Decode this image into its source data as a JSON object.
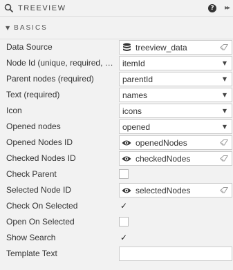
{
  "header": {
    "title": "TREEVIEW",
    "help_glyph": "?",
    "expand_glyph": "▸▸"
  },
  "section": {
    "caret": "▼",
    "title": "BASICS"
  },
  "rows": [
    {
      "label": "Data Source",
      "type": "binding",
      "icon": "database-icon",
      "value": "treeview_data"
    },
    {
      "label": "Node Id (unique, required, …",
      "type": "select",
      "value": "itemId"
    },
    {
      "label": "Parent nodes (required)",
      "type": "select",
      "value": "parentId"
    },
    {
      "label": "Text (required)",
      "type": "select",
      "value": "names"
    },
    {
      "label": "Icon",
      "type": "select",
      "value": "icons"
    },
    {
      "label": "Opened nodes",
      "type": "select",
      "value": "opened"
    },
    {
      "label": "Opened Nodes ID",
      "type": "binding",
      "icon": "eye-icon",
      "value": "openedNodes"
    },
    {
      "label": "Checked Nodes ID",
      "type": "binding",
      "icon": "eye-icon",
      "value": "checkedNodes"
    },
    {
      "label": "Check Parent",
      "type": "checkbox",
      "checked": false
    },
    {
      "label": "Selected Node ID",
      "type": "binding",
      "icon": "eye-icon",
      "value": "selectedNodes"
    },
    {
      "label": "Check On Selected",
      "type": "checkbox",
      "checked": true
    },
    {
      "label": "Open On Selected",
      "type": "checkbox",
      "checked": false
    },
    {
      "label": "Show Search",
      "type": "checkbox",
      "checked": true
    },
    {
      "label": "Template Text",
      "type": "text",
      "value": ""
    }
  ],
  "glyphs": {
    "dropdown": "▼",
    "check": "✓"
  }
}
